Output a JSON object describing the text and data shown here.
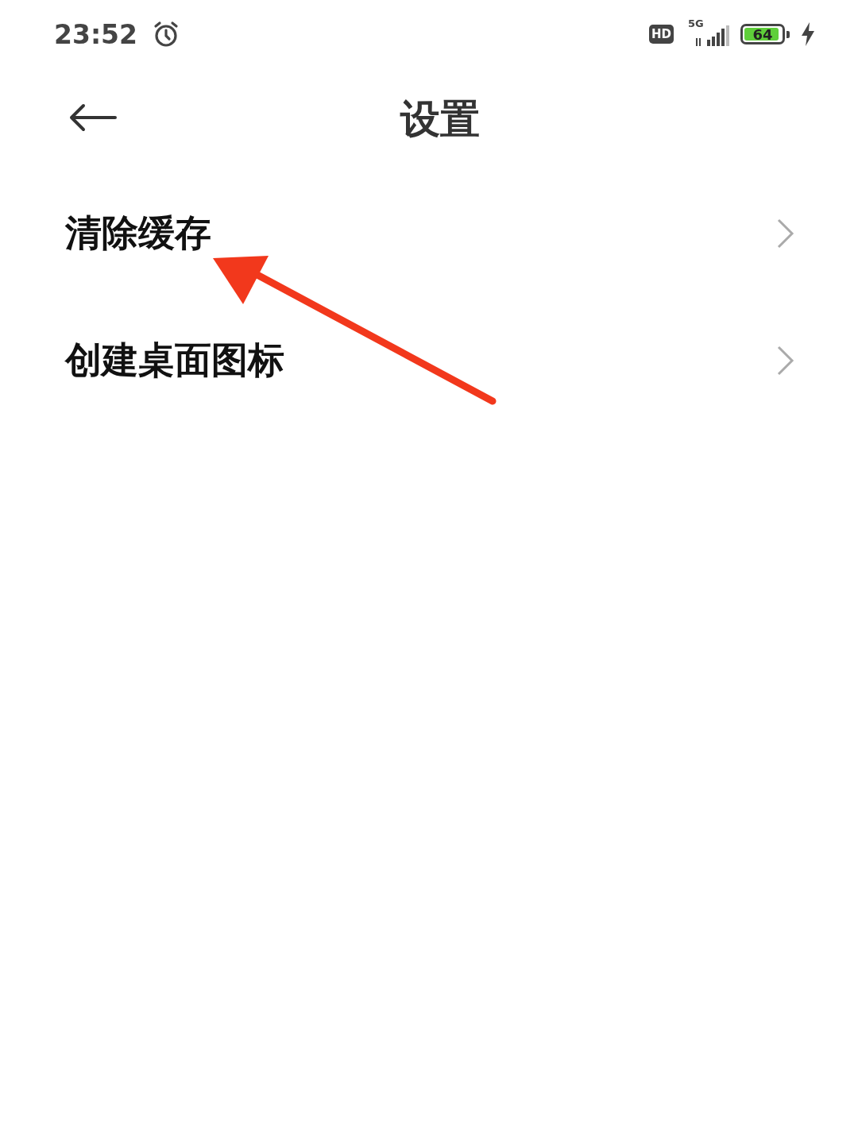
{
  "status_bar": {
    "time": "23:52",
    "hd": "HD",
    "network": "5G",
    "battery": "64",
    "charging": true
  },
  "header": {
    "title": "设置"
  },
  "items": [
    {
      "label": "清除缓存"
    },
    {
      "label": "创建桌面图标"
    }
  ],
  "annotation": {
    "kind": "arrow"
  }
}
